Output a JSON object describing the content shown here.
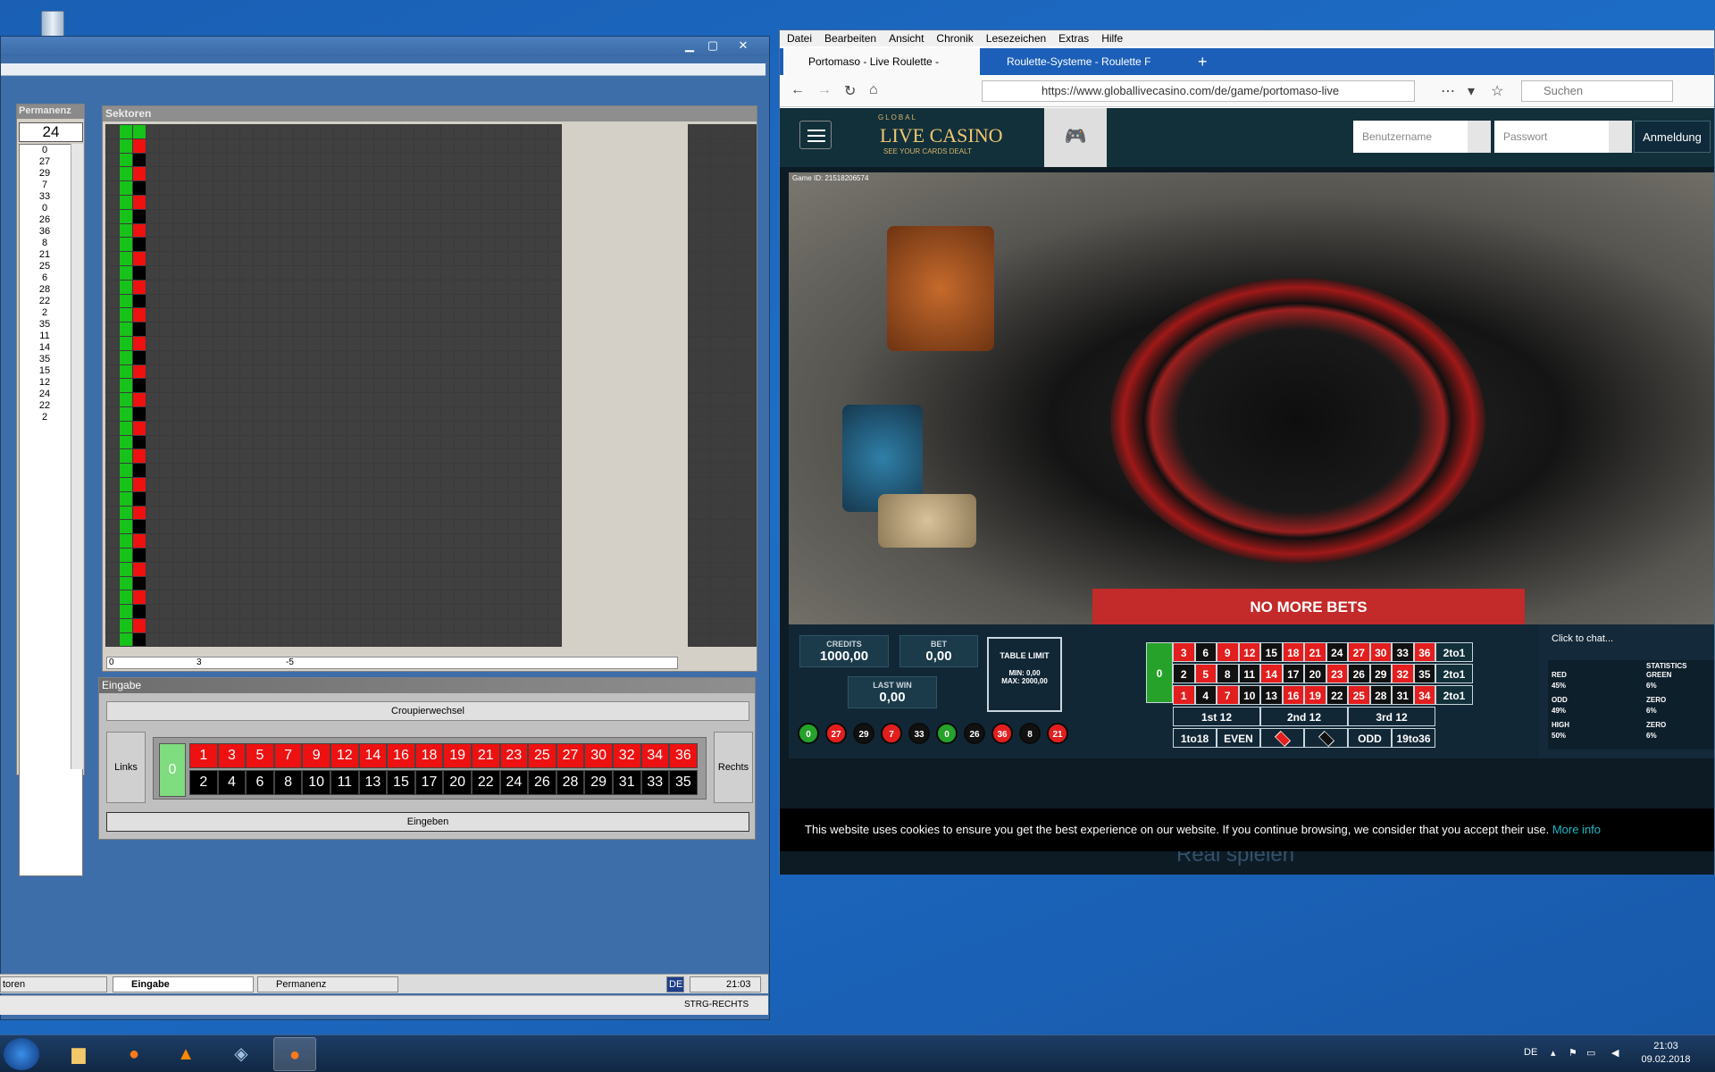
{
  "desktop": {
    "recycle_bin_label": "Papierkorb"
  },
  "vm": {
    "permanenz": {
      "title": "Permanenz",
      "current": "24",
      "list": [
        "0",
        "27",
        "29",
        "7",
        "33",
        "0",
        "26",
        "36",
        "8",
        "21",
        "25",
        "6",
        "28",
        "22",
        "2",
        "35",
        "11",
        "14",
        "35",
        "15",
        "12",
        "24",
        "22",
        "2"
      ]
    },
    "sektoren": {
      "title": "Sektoren",
      "footer": [
        "0",
        "3",
        "-5",
        ""
      ]
    },
    "eingabe": {
      "title": "Eingabe",
      "croupier_label": "Croupierwechsel",
      "links_label": "Links",
      "rechts_label": "Rechts",
      "zero": "0",
      "red_numbers": [
        "1",
        "3",
        "5",
        "7",
        "9",
        "12",
        "14",
        "16",
        "18",
        "19",
        "21",
        "23",
        "25",
        "27",
        "30",
        "32",
        "34",
        "36"
      ],
      "black_numbers": [
        "2",
        "4",
        "6",
        "8",
        "10",
        "11",
        "13",
        "15",
        "17",
        "20",
        "22",
        "24",
        "26",
        "28",
        "29",
        "31",
        "33",
        "35"
      ],
      "eingeben_label": "Eingeben"
    },
    "taskbar": {
      "items": [
        "toren",
        "Eingabe",
        "Permanenz"
      ],
      "lang": "DE",
      "time": "21:03",
      "status_text": "STRG-RECHTS"
    }
  },
  "firefox": {
    "menu": [
      "Datei",
      "Bearbeiten",
      "Ansicht",
      "Chronik",
      "Lesezeichen",
      "Extras",
      "Hilfe"
    ],
    "tabs": [
      {
        "title": "Portomaso - Live Roulette -"
      },
      {
        "title": "Roulette-Systeme - Roulette F"
      }
    ],
    "url": "https://www.globallivecasino.com/de/game/portomaso-live",
    "search_placeholder": "Suchen"
  },
  "casino": {
    "logo_top": "GLOBAL",
    "logo_main": "LIVE CASINO",
    "logo_sub": "SEE YOUR CARDS DEALT",
    "username_placeholder": "Benutzername",
    "password_placeholder": "Passwort",
    "login_label": "Anmeldung",
    "game_id": "Game ID: 21518206574",
    "no_more_bets": "NO MORE BETS",
    "credits_label": "CREDITS",
    "credits_value": "1000,00",
    "bet_label": "BET",
    "bet_value": "0,00",
    "last_win_label": "LAST WIN",
    "last_win_value": "0,00",
    "table_limit_label": "TABLE LIMIT",
    "table_limit_min": "MIN: 0,00",
    "table_limit_max": "MAX: 2000,00",
    "history": [
      {
        "n": "0",
        "c": "#26a12a"
      },
      {
        "n": "27",
        "c": "#e31e1e"
      },
      {
        "n": "29",
        "c": "#111"
      },
      {
        "n": "7",
        "c": "#e31e1e"
      },
      {
        "n": "33",
        "c": "#111"
      },
      {
        "n": "0",
        "c": "#26a12a"
      },
      {
        "n": "26",
        "c": "#111"
      },
      {
        "n": "36",
        "c": "#e31e1e"
      },
      {
        "n": "8",
        "c": "#111"
      },
      {
        "n": "21",
        "c": "#e31e1e"
      }
    ],
    "board_rows": [
      [
        {
          "n": "3",
          "c": "r"
        },
        {
          "n": "6",
          "c": "k"
        },
        {
          "n": "9",
          "c": "r"
        },
        {
          "n": "12",
          "c": "r"
        },
        {
          "n": "15",
          "c": "k"
        },
        {
          "n": "18",
          "c": "r"
        },
        {
          "n": "21",
          "c": "r"
        },
        {
          "n": "24",
          "c": "k"
        },
        {
          "n": "27",
          "c": "r"
        },
        {
          "n": "30",
          "c": "r"
        },
        {
          "n": "33",
          "c": "k"
        },
        {
          "n": "36",
          "c": "r"
        }
      ],
      [
        {
          "n": "2",
          "c": "k"
        },
        {
          "n": "5",
          "c": "r"
        },
        {
          "n": "8",
          "c": "k"
        },
        {
          "n": "11",
          "c": "k"
        },
        {
          "n": "14",
          "c": "r"
        },
        {
          "n": "17",
          "c": "k"
        },
        {
          "n": "20",
          "c": "k"
        },
        {
          "n": "23",
          "c": "r"
        },
        {
          "n": "26",
          "c": "k"
        },
        {
          "n": "29",
          "c": "k"
        },
        {
          "n": "32",
          "c": "r"
        },
        {
          "n": "35",
          "c": "k"
        }
      ],
      [
        {
          "n": "1",
          "c": "r"
        },
        {
          "n": "4",
          "c": "k"
        },
        {
          "n": "7",
          "c": "r"
        },
        {
          "n": "10",
          "c": "k"
        },
        {
          "n": "13",
          "c": "k"
        },
        {
          "n": "16",
          "c": "r"
        },
        {
          "n": "19",
          "c": "r"
        },
        {
          "n": "22",
          "c": "k"
        },
        {
          "n": "25",
          "c": "r"
        },
        {
          "n": "28",
          "c": "k"
        },
        {
          "n": "31",
          "c": "k"
        },
        {
          "n": "34",
          "c": "r"
        }
      ]
    ],
    "column_bet": "2to1",
    "board_zero": "0",
    "dozens": [
      "1st 12",
      "2nd 12",
      "3rd 12"
    ],
    "outside": [
      "1to18",
      "EVEN",
      "",
      "",
      "ODD",
      "19to36"
    ],
    "chat_placeholder": "Click to chat...",
    "stats": {
      "title": "STATISTICS",
      "rows": [
        {
          "left": "RED",
          "right": "GREEN",
          "lp": "45%",
          "rp": "6%"
        },
        {
          "left": "ODD",
          "right": "ZERO",
          "lp": "49%",
          "rp": "6%"
        },
        {
          "left": "HIGH",
          "right": "ZERO",
          "lp": "50%",
          "rp": "6%"
        }
      ]
    },
    "real_play": "Real spielen",
    "cookie_text": "This website uses cookies to ensure you get the best experience on our website. If you continue browsing, we consider that you accept their use.",
    "cookie_more": "More info"
  },
  "taskbar": {
    "lang": "DE",
    "time": "21:03",
    "date": "09.02.2018"
  }
}
